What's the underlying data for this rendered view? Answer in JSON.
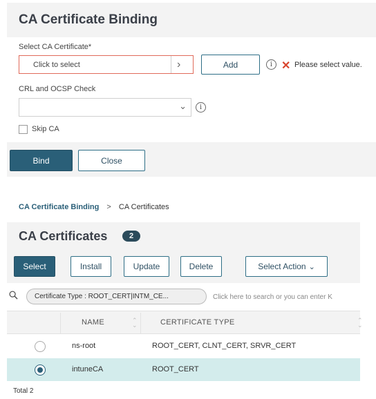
{
  "dialog": {
    "title": "CA Certificate Binding",
    "select_label": "Select CA Certificate*",
    "select_placeholder": "Click to select",
    "add_button": "Add",
    "error_message": "Please select value.",
    "crl_label": "CRL and OCSP Check",
    "crl_value": "",
    "skip_ca_label": "Skip CA",
    "skip_ca_checked": false,
    "bind_button": "Bind",
    "close_button": "Close"
  },
  "breadcrumb": {
    "parent": "CA Certificate Binding",
    "separator": ">",
    "current": "CA Certificates"
  },
  "panel": {
    "title": "CA Certificates",
    "count": "2"
  },
  "toolbar": {
    "select": "Select",
    "install": "Install",
    "update": "Update",
    "delete": "Delete",
    "select_action": "Select Action"
  },
  "search": {
    "filter_chip": "Certificate Type : ROOT_CERT|INTM_CE...",
    "placeholder": "Click here to search or you can enter K"
  },
  "table": {
    "columns": [
      "NAME",
      "CERTIFICATE TYPE"
    ],
    "rows": [
      {
        "name": "ns-root",
        "type": "ROOT_CERT, CLNT_CERT, SRVR_CERT",
        "selected": false
      },
      {
        "name": "intuneCA",
        "type": "ROOT_CERT",
        "selected": true
      }
    ]
  },
  "footer": {
    "total": "Total 2"
  },
  "colors": {
    "primary": "#2a5f78",
    "error": "#d9462f",
    "selected_row": "#d3ecec",
    "header_bg": "#f3f3f3"
  },
  "icons": [
    "chevron-right-icon",
    "info-icon",
    "error-x-icon",
    "chevron-down-icon",
    "search-icon",
    "sort-icon"
  ]
}
